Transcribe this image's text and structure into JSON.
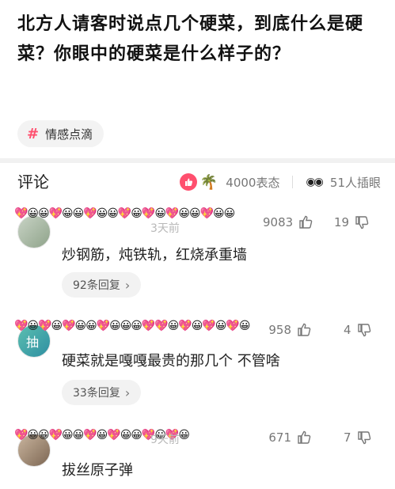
{
  "question": {
    "title": "北方人请客时说点几个硬菜，到底什么是硬菜？你眼中的硬菜是什么样子的？"
  },
  "tag": {
    "symbol": "#",
    "label": "情感点滴"
  },
  "comments_header": {
    "title": "评论",
    "reaction_count": "4000表态",
    "insert_count": "51人插眼"
  },
  "comments": [
    {
      "name_emojis": "💖😀😀💖😀😀💖😀😀💖😀💖😀💖😀😀💖😀😀",
      "meta": "3天前",
      "likes": "9083",
      "dislikes": "19",
      "text": "炒钢筋，炖铁轨，红烧承重墙",
      "replies": "92条回复"
    },
    {
      "name_emojis": "💖😀💖😀💖😀😀💖😀😀😀💖💖😀💖😀💖😀💖😀",
      "meta": "",
      "likes": "958",
      "dislikes": "4",
      "text": "硬菜就是嘎嘎最贵的那几个 不管啥",
      "replies": "33条回复"
    },
    {
      "name_emojis": "💖😀😀💖😀😀💖😀💖😀😀💖😀💖😀",
      "meta": "9天前",
      "likes": "671",
      "dislikes": "7",
      "text": "拔丝原子弹",
      "replies": ""
    }
  ],
  "colors": {
    "accent": "#ff4f6e",
    "background": "#f1f1f1"
  }
}
